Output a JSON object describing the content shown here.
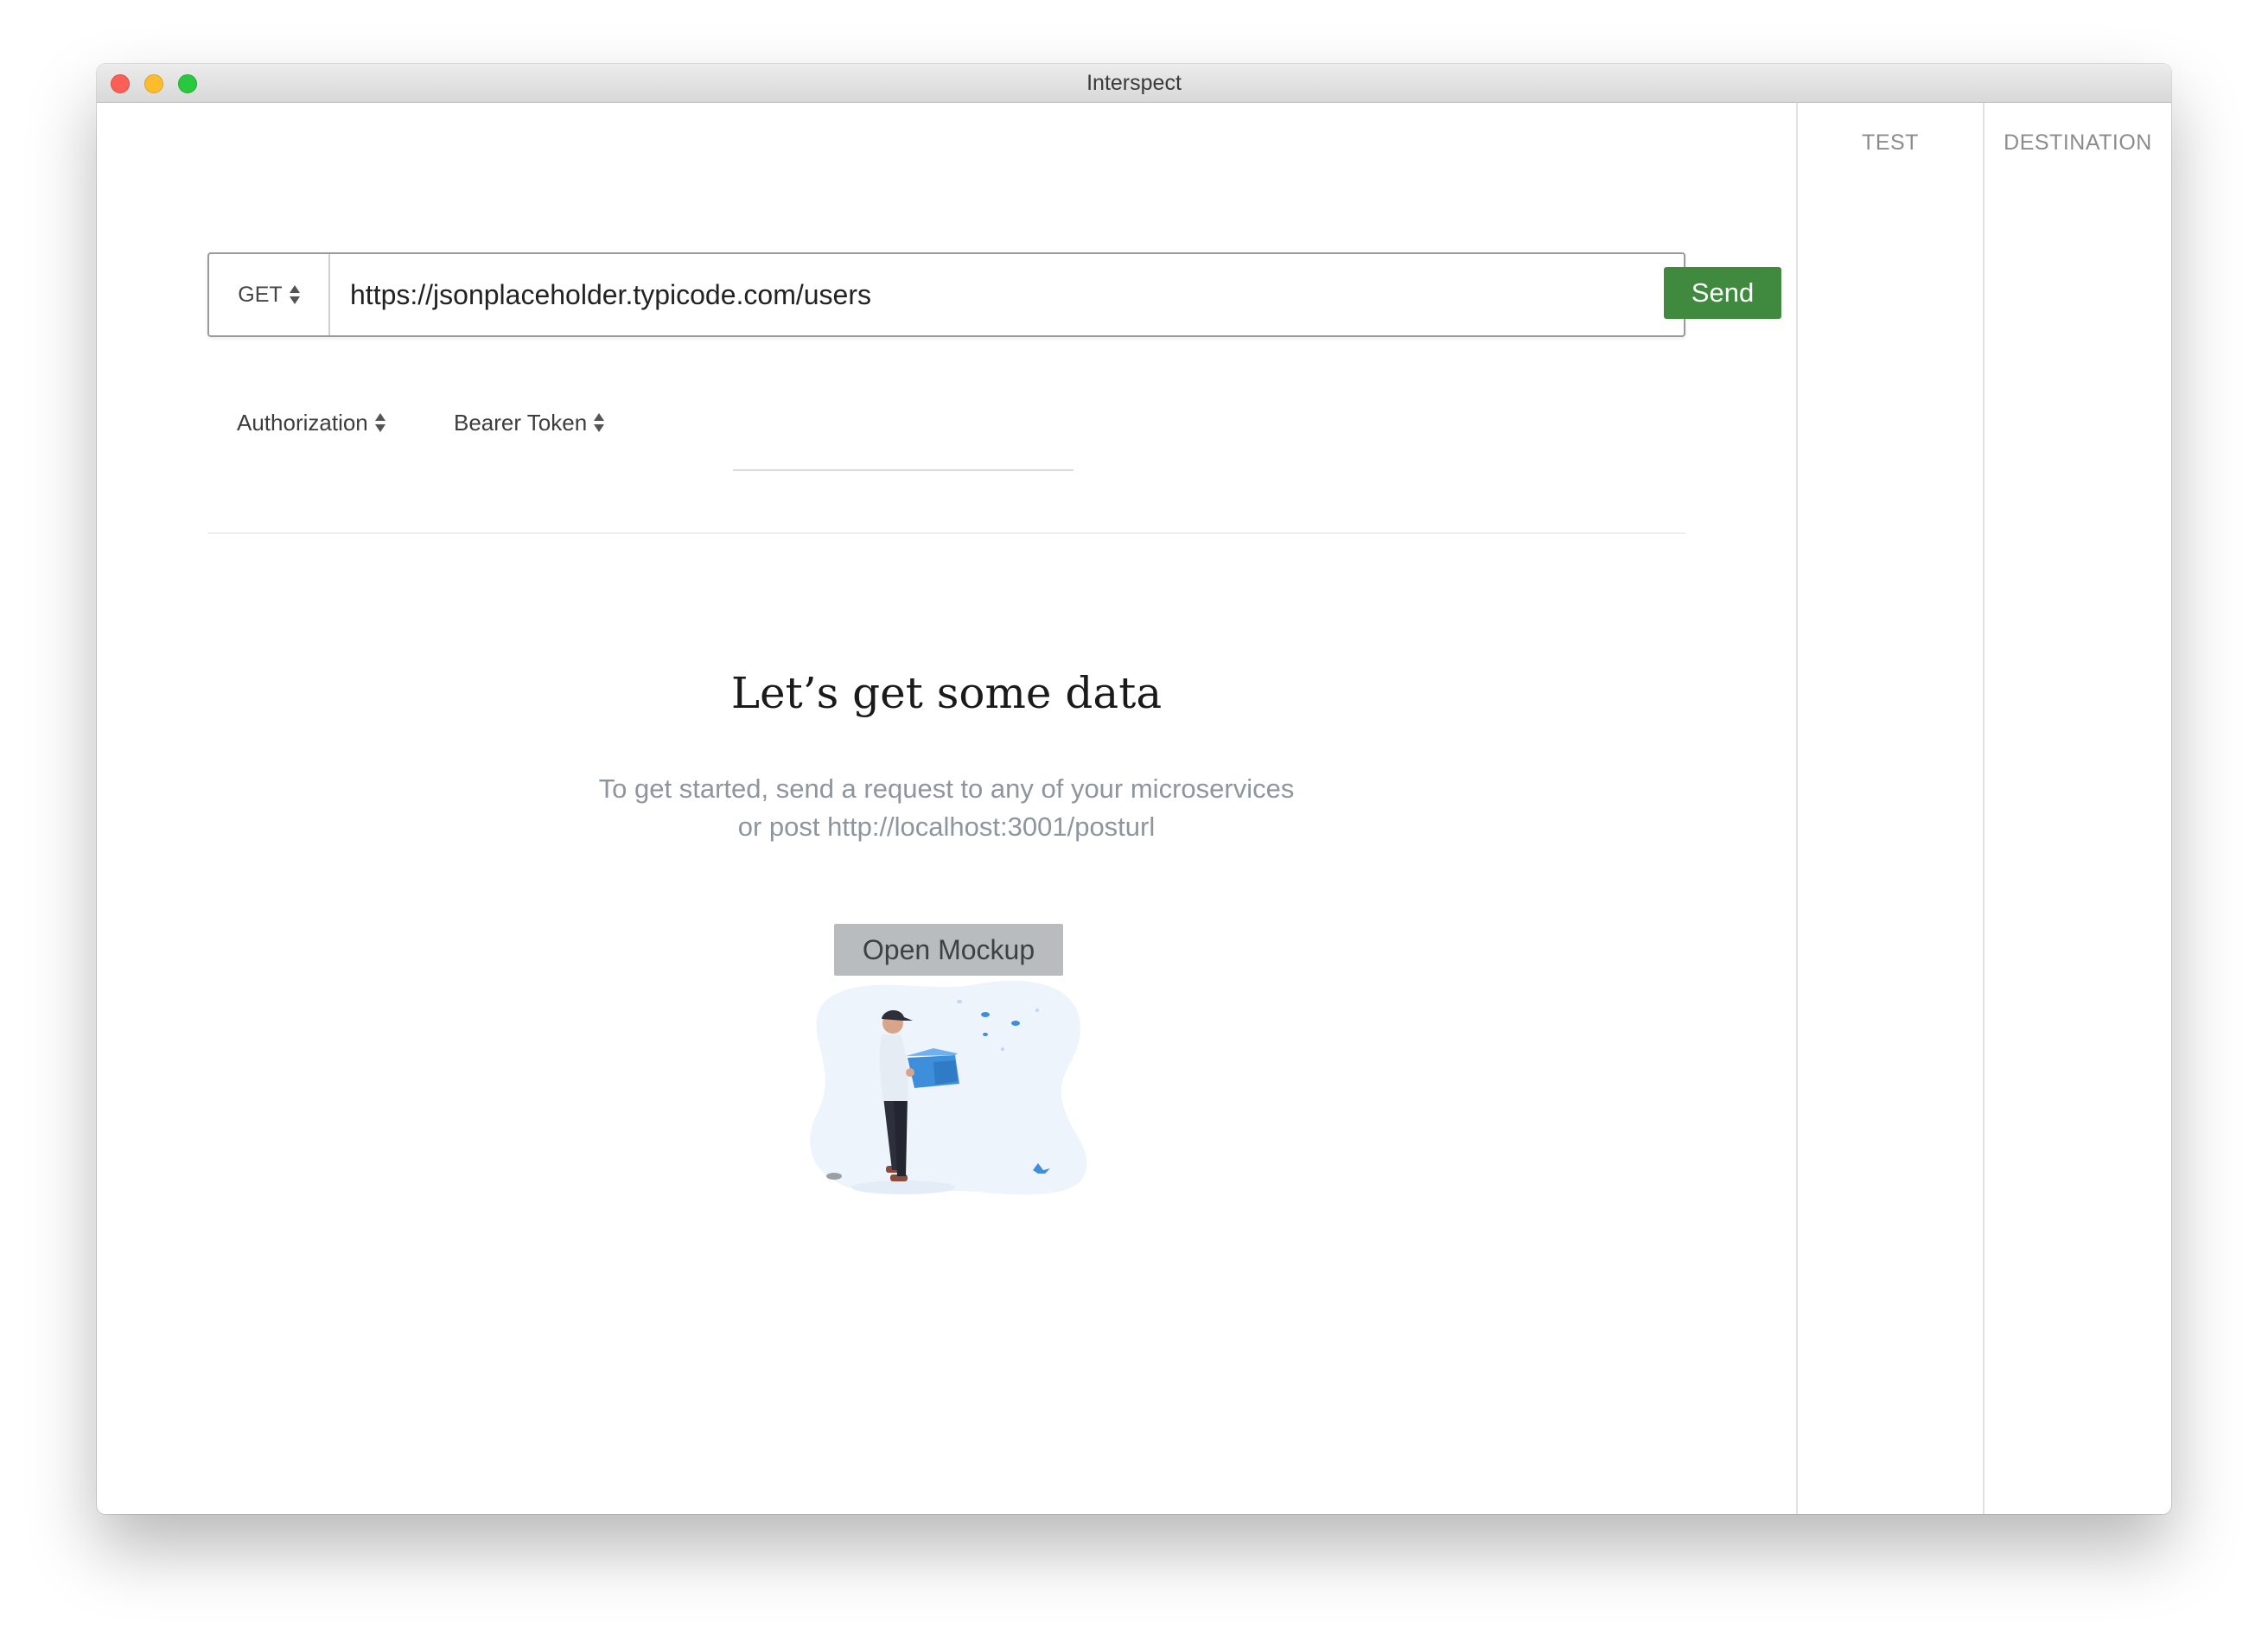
{
  "window": {
    "title": "Interspect"
  },
  "request": {
    "method": "GET",
    "url": "https://jsonplaceholder.typicode.com/users",
    "send_label": "Send"
  },
  "auth": {
    "type_label": "Authorization",
    "token_type_label": "Bearer Token",
    "token_value": ""
  },
  "empty_state": {
    "title": "Let’s get some data",
    "subtitle_line1": "To get started, send a request to any of your microservices",
    "subtitle_line2": "or post http://localhost:3001/posturl",
    "button_label": "Open Mockup"
  },
  "side_columns": {
    "test_label": "TEST",
    "destination_label": "DESTINATION"
  },
  "colors": {
    "send_button": "#3f8a3f",
    "open_mockup_button": "#b8bcbf",
    "illustration_accent": "#3d8fdc"
  }
}
